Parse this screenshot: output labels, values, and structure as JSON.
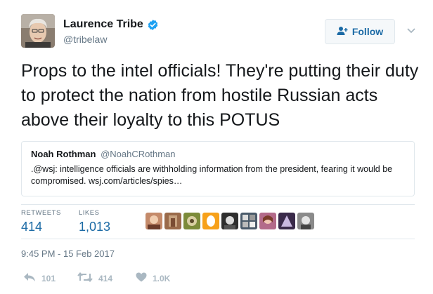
{
  "author": {
    "name": "Laurence Tribe",
    "handle": "@tribelaw",
    "verified": true
  },
  "follow_button": {
    "label": "Follow",
    "icon": "add-user-icon"
  },
  "tweet": {
    "text": "Props to the intel officials! They're putting their duty to protect the nation from hostile Russian acts above their loyalty to this POTUS"
  },
  "quoted_tweet": {
    "name": "Noah Rothman",
    "handle": "@NoahCRothman",
    "text": ".@wsj: intelligence officials are withholding information from the president, fearing it would be compromised. wsj.com/articles/spies…"
  },
  "stats": {
    "retweets_label": "RETWEETS",
    "retweets_value": "414",
    "likes_label": "LIKES",
    "likes_value": "1,013"
  },
  "likers": [
    "liker-avatar-1",
    "liker-avatar-2",
    "liker-avatar-3",
    "liker-avatar-4",
    "liker-avatar-5",
    "liker-avatar-6",
    "liker-avatar-7",
    "liker-avatar-8",
    "liker-avatar-9"
  ],
  "timestamp": "9:45 PM - 15 Feb 2017",
  "actions": {
    "reply_count": "101",
    "retweet_count": "414",
    "like_count": "1.0K"
  },
  "colors": {
    "link_blue": "#1b6aa5",
    "verified_blue": "#1da1f2",
    "muted_gray": "#657786",
    "border": "#e1e8ed",
    "action_gray": "#aab8c2"
  }
}
